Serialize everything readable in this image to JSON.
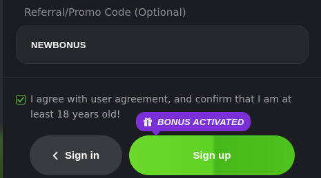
{
  "colors": {
    "background": "#1c1d21",
    "input_bg": "#26272c",
    "accent_green": "#5fd325",
    "badge_purple": "#7a30d6",
    "secondary_button": "#3a3b40"
  },
  "promo": {
    "label": "Referral/Promo Code (Optional)",
    "value": "NEWBONUS"
  },
  "agreement": {
    "checked": true,
    "text": "I agree with user agreement, and confirm that I am at least 18 years old!"
  },
  "badge": {
    "icon": "gift-icon",
    "text": "BONUS ACTIVATED"
  },
  "actions": {
    "signin_label": "Sign in",
    "signin_icon": "chevron-left-icon",
    "signup_label": "Sign up"
  }
}
